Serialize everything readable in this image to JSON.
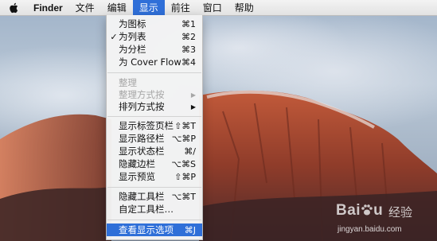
{
  "menubar": {
    "app_name": "Finder",
    "menus": [
      "文件",
      "编辑",
      "显示",
      "前往",
      "窗口",
      "帮助"
    ],
    "active_menu": "显示"
  },
  "view_menu": {
    "items": [
      {
        "label": "为图标",
        "shortcut": "⌘1",
        "checked": false
      },
      {
        "label": "为列表",
        "shortcut": "⌘2",
        "checked": true
      },
      {
        "label": "为分栏",
        "shortcut": "⌘3",
        "checked": false
      },
      {
        "label": "为 Cover Flow",
        "shortcut": "⌘4",
        "checked": false
      },
      {
        "label": "整理",
        "disabled": true
      },
      {
        "label": "整理方式按",
        "disabled": true,
        "submenu": true
      },
      {
        "label": "排列方式按",
        "submenu": true
      },
      {
        "label": "显示标签页栏",
        "shortcut": "⇧⌘T"
      },
      {
        "label": "显示路径栏",
        "shortcut": "⌥⌘P"
      },
      {
        "label": "显示状态栏",
        "shortcut": "⌘/"
      },
      {
        "label": "隐藏边栏",
        "shortcut": "⌥⌘S"
      },
      {
        "label": "显示预览",
        "shortcut": "⇧⌘P"
      },
      {
        "label": "隐藏工具栏",
        "shortcut": "⌥⌘T"
      },
      {
        "label": "自定工具栏…"
      },
      {
        "label": "查看显示选项",
        "shortcut": "⌘J",
        "highlighted": true
      }
    ],
    "check_mark": "✓",
    "submenu_arrow": "▶"
  },
  "watermark": {
    "brand": "Bai",
    "brand_suffix": "经验",
    "url": "jingyan.baidu.com"
  },
  "colors": {
    "highlight": "#2f6fd8",
    "menubar": "#ececec"
  },
  "icons": {
    "apple": "apple-logo-icon",
    "baidu": "baidu-paw-icon"
  }
}
